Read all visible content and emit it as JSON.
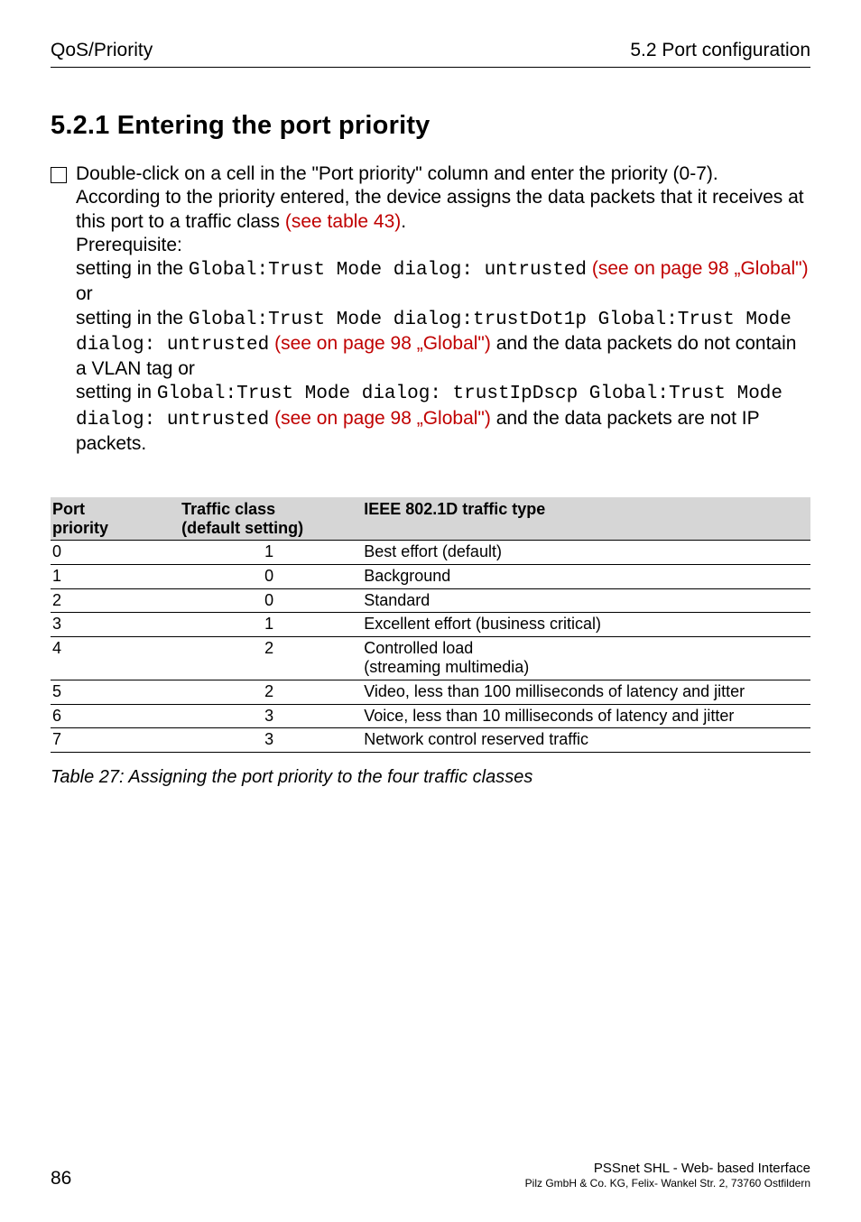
{
  "header": {
    "left": "QoS/Priority",
    "right": "5.2  Port configuration"
  },
  "section_title": "5.2.1   Entering the port priority",
  "body": {
    "p1a": "Double-click on a cell in the \"Port priority\" column and enter the priority (0-7).",
    "p1b": "According to the priority entered, the device assigns the data packets that it receives at this port to a traffic class ",
    "p1b_link": "(see table 43)",
    "p1b_end": ".",
    "prereq_label": "Prerequisite:",
    "s1_a": "setting in the ",
    "s1_mono": "Global:Trust Mode dialog: untrusted",
    "s1_link": "(see on page 98 „Global\")",
    "s1_c": " or",
    "s2_a": "setting in the ",
    "s2_mono": "Global:Trust Mode dialog:trustDot1p Global:Trust Mode dialog: untrusted",
    "s2_link": "(see on page 98 „Global\")",
    "s2_c": " and the data packets do not contain a VLAN tag or",
    "s3_a": "setting in ",
    "s3_mono": "Global:Trust Mode dialog: trustIpDscp Global:Trust Mode dialog: untrusted",
    "s3_link": "(see on page 98 „Global\")",
    "s3_c": " and the data packets are not IP packets."
  },
  "table": {
    "headers": {
      "h1a": "Port",
      "h1b": "priority",
      "h2a": "Traffic class",
      "h2b": "(default setting)",
      "h3": "IEEE 802.1D traffic type"
    },
    "rows": [
      {
        "p": "0",
        "tc": "1",
        "type": "Best effort (default)"
      },
      {
        "p": "1",
        "tc": "0",
        "type": "Background"
      },
      {
        "p": "2",
        "tc": "0",
        "type": "Standard"
      },
      {
        "p": "3",
        "tc": "1",
        "type": "Excellent effort (business critical)"
      },
      {
        "p": "4",
        "tc": "2",
        "type": "Controlled load\n(streaming multimedia)"
      },
      {
        "p": "5",
        "tc": "2",
        "type": "Video, less than 100 milliseconds of latency and jitter"
      },
      {
        "p": "6",
        "tc": "3",
        "type": "Voice, less than 10 milliseconds of latency and jitter"
      },
      {
        "p": "7",
        "tc": "3",
        "type": "Network control reserved traffic"
      }
    ]
  },
  "caption": "Table 27: Assigning the port priority to the four traffic classes",
  "footer": {
    "page_number": "86",
    "product": "PSSnet SHL - Web- based Interface",
    "company": "Pilz GmbH & Co. KG, Felix- Wankel Str. 2, 73760 Ostfildern"
  }
}
